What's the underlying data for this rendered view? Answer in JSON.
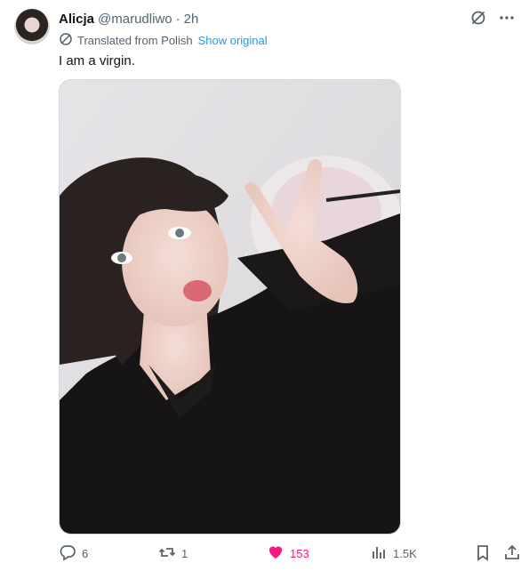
{
  "tweet": {
    "author_name": "Alicja",
    "handle": "@marudliwo",
    "separator": "·",
    "time": "2h",
    "translation_note": "Translated from Polish",
    "show_original_label": "Show original",
    "text": "I am a virgin."
  },
  "metrics": {
    "replies": "6",
    "reposts": "1",
    "likes": "153",
    "views": "1.5K"
  },
  "colors": {
    "link": "#1d9bf0",
    "like": "#f91880",
    "muted": "#536471",
    "text": "#0f1419"
  },
  "icons": {
    "reply": "reply-icon",
    "repost": "repost-icon",
    "like": "heart-icon",
    "views": "views-icon",
    "bookmark": "bookmark-icon",
    "share": "share-icon",
    "grok": "slash-circle-icon",
    "more": "more-icon",
    "translate": "translate-icon"
  }
}
